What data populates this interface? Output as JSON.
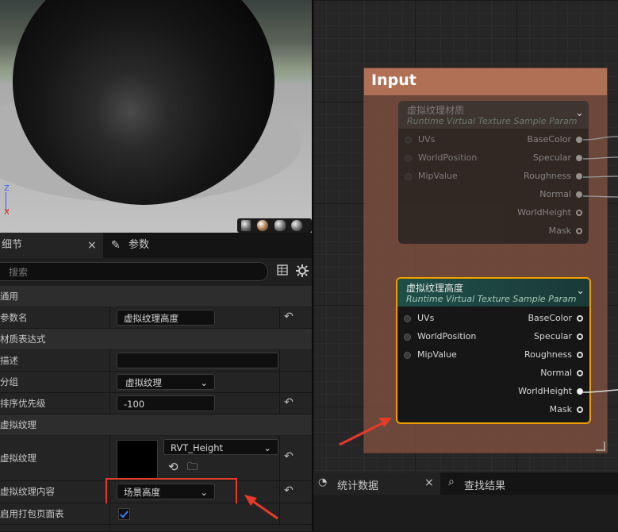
{
  "viewport": {
    "axis_z": "Z",
    "axis_x": "X",
    "preview_shapes": [
      "cylinder-preview",
      "sphere-preview",
      "plane-preview",
      "cube-preview",
      "mesh-preview"
    ]
  },
  "details": {
    "tabs": [
      {
        "label": "细节",
        "close": "×"
      },
      {
        "label": "参数"
      }
    ],
    "search_placeholder": "搜索",
    "categories": {
      "general": "通用",
      "material_expression": "材质表达式",
      "virtual_texture": "虚拟纹理"
    },
    "rows": {
      "param_name": {
        "label": "参数名",
        "value": "虚拟纹理高度"
      },
      "description": {
        "label": "描述",
        "value": ""
      },
      "group": {
        "label": "分组",
        "value": "虚拟纹理"
      },
      "sort_priority": {
        "label": "排序优先级",
        "value": "-100"
      },
      "virtual_texture": {
        "label": "虚拟纹理",
        "asset": "RVT_Height"
      },
      "vt_content": {
        "label": "虚拟纹理内容",
        "value": "场景高度"
      },
      "enable_pack": {
        "label": "启用打包页面表",
        "checked": true
      }
    }
  },
  "graph": {
    "comment_title": "Input",
    "node1": {
      "title": "虚拟纹理材质",
      "subtitle": "Runtime Virtual Texture Sample Param",
      "inputs": [
        "UVs",
        "WorldPosition",
        "MipValue"
      ],
      "outputs": [
        "BaseColor",
        "Specular",
        "Roughness",
        "Normal",
        "WorldHeight",
        "Mask"
      ]
    },
    "node2": {
      "title": "虚拟纹理高度",
      "subtitle": "Runtime Virtual Texture Sample Param",
      "inputs": [
        "UVs",
        "WorldPosition",
        "MipValue"
      ],
      "outputs": [
        "BaseColor",
        "Specular",
        "Roughness",
        "Normal",
        "WorldHeight",
        "Mask"
      ]
    }
  },
  "bottom_tabs": [
    {
      "label": "统计数据",
      "close": "×"
    },
    {
      "label": "查找结果"
    }
  ],
  "colors": {
    "comment_header": "#b07055",
    "node2_header": "#1f4f4a",
    "selection_orange": "#f0a000",
    "annotation_red": "#e83a2a"
  }
}
